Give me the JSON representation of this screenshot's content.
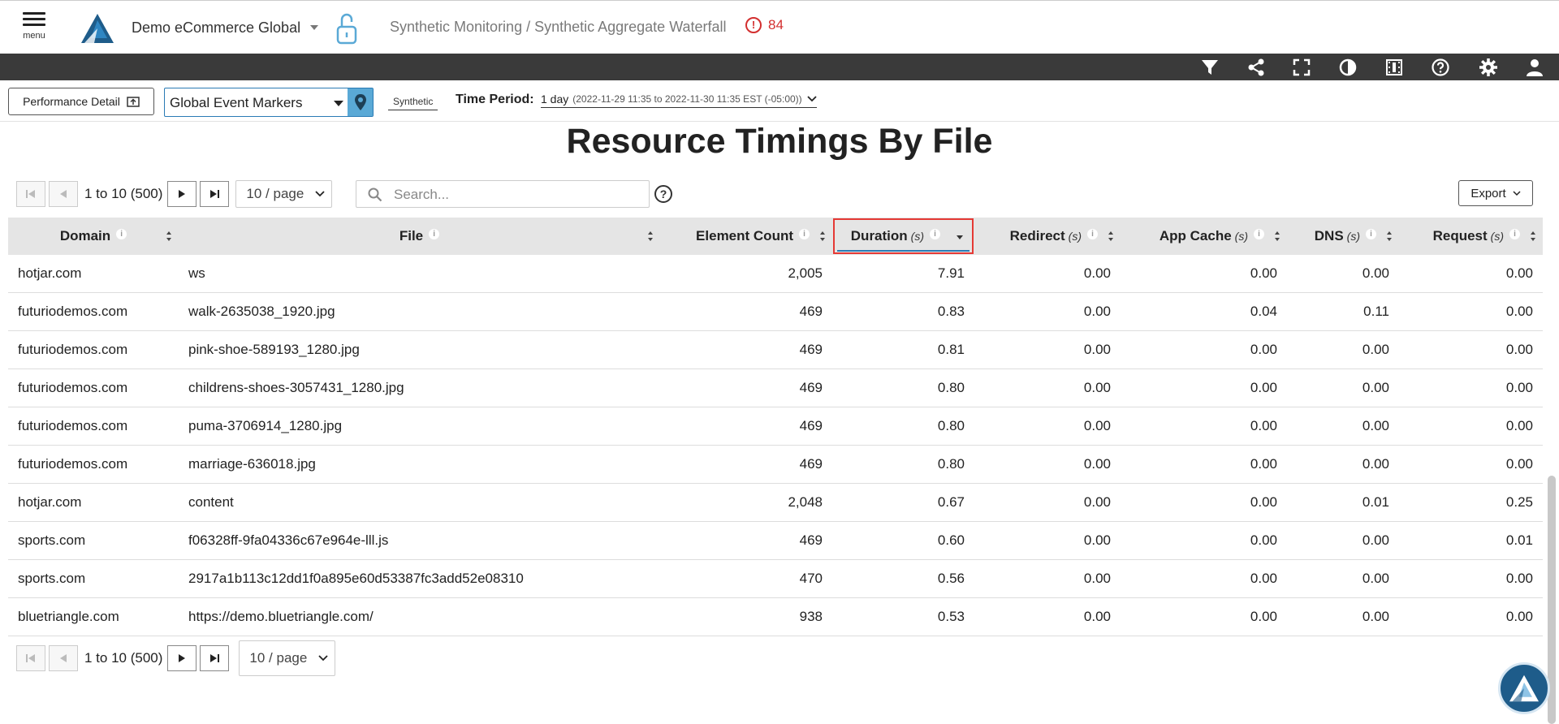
{
  "header": {
    "menu_label": "menu",
    "org_name": "Demo eCommerce Global",
    "breadcrumb": "Synthetic Monitoring / Synthetic Aggregate Waterfall",
    "alert_count": "84"
  },
  "toolbar_icons": [
    "filter-icon",
    "share-icon",
    "fullscreen-icon",
    "contrast-icon",
    "film-icon",
    "help-icon",
    "gear-icon",
    "user-icon"
  ],
  "filters": {
    "performance_detail_label": "Performance Detail",
    "event_markers_value": "Global Event Markers",
    "synthetic_tab": "Synthetic",
    "time_period_label": "Time Period:",
    "time_period_value": "1 day",
    "time_period_range": "(2022-11-29 11:35 to 2022-11-30 11:35 EST (-05:00))"
  },
  "page_title": "Resource Timings By File",
  "pagination": {
    "range_text": "1 to 10 (500)",
    "per_page": "10 / page",
    "search_placeholder": "Search...",
    "help_glyph": "?",
    "export_label": "Export"
  },
  "table": {
    "columns": [
      {
        "label": "Domain",
        "unit": ""
      },
      {
        "label": "File",
        "unit": ""
      },
      {
        "label": "Element Count",
        "unit": ""
      },
      {
        "label": "Duration",
        "unit": "(s)"
      },
      {
        "label": "Redirect",
        "unit": "(s)"
      },
      {
        "label": "App Cache",
        "unit": "(s)"
      },
      {
        "label": "DNS",
        "unit": "(s)"
      },
      {
        "label": "Request",
        "unit": "(s)"
      }
    ],
    "sorted_column": "Duration",
    "rows": [
      [
        "hotjar.com",
        "ws",
        "2,005",
        "7.91",
        "0.00",
        "0.00",
        "0.00",
        "0.00"
      ],
      [
        "futuriodemos.com",
        "walk-2635038_1920.jpg",
        "469",
        "0.83",
        "0.00",
        "0.04",
        "0.11",
        "0.00"
      ],
      [
        "futuriodemos.com",
        "pink-shoe-589193_1280.jpg",
        "469",
        "0.81",
        "0.00",
        "0.00",
        "0.00",
        "0.00"
      ],
      [
        "futuriodemos.com",
        "childrens-shoes-3057431_1280.jpg",
        "469",
        "0.80",
        "0.00",
        "0.00",
        "0.00",
        "0.00"
      ],
      [
        "futuriodemos.com",
        "puma-3706914_1280.jpg",
        "469",
        "0.80",
        "0.00",
        "0.00",
        "0.00",
        "0.00"
      ],
      [
        "futuriodemos.com",
        "marriage-636018.jpg",
        "469",
        "0.80",
        "0.00",
        "0.00",
        "0.00",
        "0.00"
      ],
      [
        "hotjar.com",
        "content",
        "2,048",
        "0.67",
        "0.00",
        "0.00",
        "0.01",
        "0.25"
      ],
      [
        "sports.com",
        "f06328ff-9fa04336c67e964e-lll.js",
        "469",
        "0.60",
        "0.00",
        "0.00",
        "0.00",
        "0.01"
      ],
      [
        "sports.com",
        "2917a1b113c12dd1f0a895e60d53387fc3add52e08310",
        "470",
        "0.56",
        "0.00",
        "0.00",
        "0.00",
        "0.00"
      ],
      [
        "bluetriangle.com",
        "https://demo.bluetriangle.com/",
        "938",
        "0.53",
        "0.00",
        "0.00",
        "0.00",
        "0.00"
      ]
    ]
  },
  "colors": {
    "accent_blue": "#2a7bb5",
    "alert_red": "#d32f2f",
    "toolbar_dark": "#3a3a3a",
    "header_gray": "#e5e5e5",
    "highlight_red": "#e53935"
  }
}
